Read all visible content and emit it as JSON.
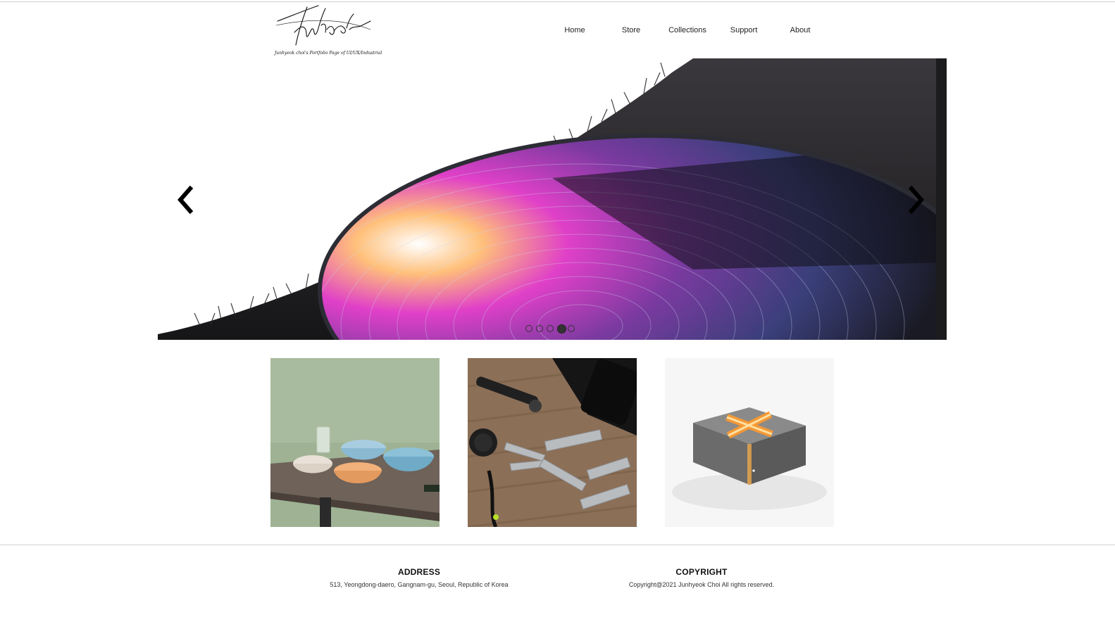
{
  "header": {
    "logo_caption": "Junhyeok choi's Portfolio Page of UI/UX/Industrial",
    "nav": [
      "Home",
      "Store",
      "Collections",
      "Support",
      "About"
    ]
  },
  "slider": {
    "prev_icon": "chevron-left-icon",
    "next_icon": "chevron-right-icon",
    "dot_count": 5,
    "active_index": 3
  },
  "thumbnails": [
    {
      "subject": "ceramic bowls on wooden table"
    },
    {
      "subject": "multitool and notebook on wooden desk"
    },
    {
      "subject": "grey block lamp with glowing orange slits"
    }
  ],
  "footer": {
    "address_title": "ADDRESS",
    "address_text": "513, Yeongdong-daero, Gangnam-gu, Seoul, Republic of Korea",
    "copyright_title": "COPYRIGHT",
    "copyright_text": "Copyright@2021 Junhyeok Choi All rights reserved."
  },
  "colors": {
    "background": "#ffffff",
    "text": "#111111",
    "divider": "#d2d2d2",
    "accent_magenta": "#e040c8",
    "accent_blue": "#7fb0e8"
  }
}
